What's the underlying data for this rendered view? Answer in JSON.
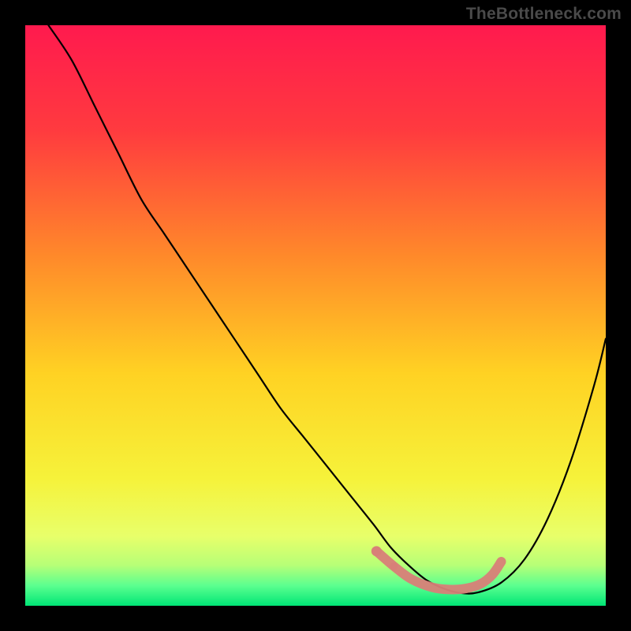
{
  "watermark": "TheBottleneck.com",
  "chart_data": {
    "type": "line",
    "title": "",
    "xlabel": "",
    "ylabel": "",
    "xlim": [
      0,
      100
    ],
    "ylim": [
      0,
      100
    ],
    "grid": false,
    "legend": "none",
    "background_gradient": {
      "stops": [
        {
          "offset": 0.0,
          "color": "#ff1a4e"
        },
        {
          "offset": 0.18,
          "color": "#ff3a3f"
        },
        {
          "offset": 0.4,
          "color": "#ff8a2a"
        },
        {
          "offset": 0.6,
          "color": "#ffd223"
        },
        {
          "offset": 0.78,
          "color": "#f6f23a"
        },
        {
          "offset": 0.88,
          "color": "#e8ff6a"
        },
        {
          "offset": 0.93,
          "color": "#b7ff77"
        },
        {
          "offset": 0.965,
          "color": "#5cff8f"
        },
        {
          "offset": 1.0,
          "color": "#00e676"
        }
      ]
    },
    "series": [
      {
        "name": "curve",
        "stroke": "#000000",
        "x": [
          4,
          8,
          12,
          16,
          20,
          24,
          28,
          32,
          36,
          40,
          44,
          48,
          52,
          56,
          60,
          63,
          66,
          69,
          72,
          75,
          78,
          82,
          86,
          90,
          94,
          98,
          100
        ],
        "y": [
          100,
          94,
          86,
          78,
          70,
          64,
          58,
          52,
          46,
          40,
          34,
          29,
          24,
          19,
          14,
          10,
          7,
          4.5,
          3,
          2.2,
          2.3,
          4,
          8,
          15,
          25,
          38,
          46
        ]
      },
      {
        "name": "trough-markers",
        "type": "scatter",
        "stroke": "#d88078",
        "fill": "#d88078",
        "x": [
          60.5,
          63.5,
          66.5,
          70.0,
          73.0,
          76.0,
          78.5,
          80.5,
          82.0
        ],
        "y": [
          9.4,
          6.8,
          4.6,
          3.2,
          2.8,
          3.0,
          3.8,
          5.4,
          7.6
        ]
      }
    ]
  }
}
